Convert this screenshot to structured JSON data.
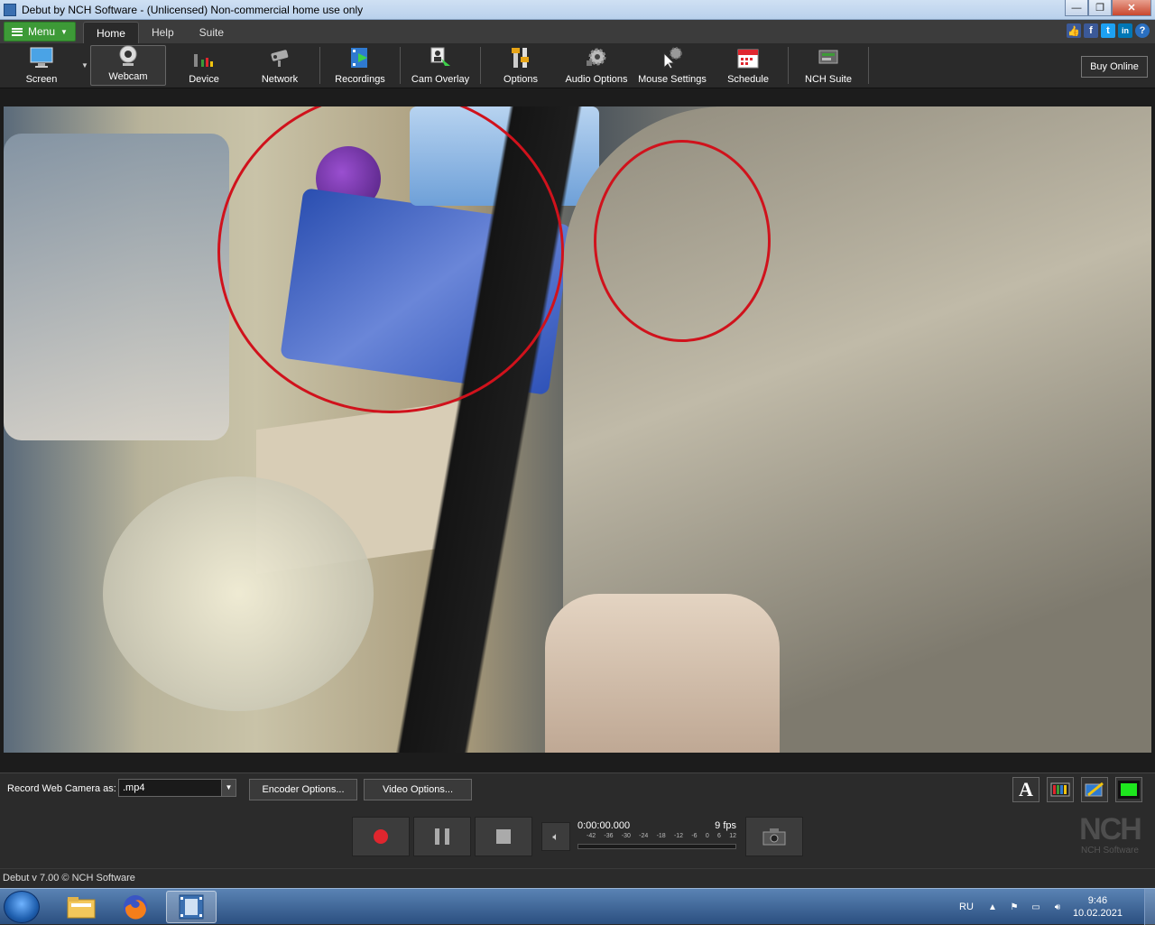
{
  "window": {
    "title": "Debut by NCH Software - (Unlicensed) Non-commercial home use only",
    "minimize": "—",
    "maximize": "❐",
    "close": "✕"
  },
  "tabs": {
    "menu_label": "Menu",
    "items": [
      "Home",
      "Help",
      "Suite"
    ],
    "active": "Home"
  },
  "social": [
    "👍",
    "f",
    "t",
    "in",
    "?"
  ],
  "toolbar": {
    "items": [
      {
        "label": "Screen",
        "icon": "monitor-icon"
      },
      {
        "label": "Webcam",
        "icon": "webcam-icon"
      },
      {
        "label": "Device",
        "icon": "device-icon"
      },
      {
        "label": "Network",
        "icon": "network-camera-icon"
      },
      {
        "label": "Recordings",
        "icon": "recordings-icon"
      },
      {
        "label": "Cam Overlay",
        "icon": "cam-overlay-icon"
      },
      {
        "label": "Options",
        "icon": "options-icon"
      },
      {
        "label": "Audio Options",
        "icon": "audio-options-icon"
      },
      {
        "label": "Mouse Settings",
        "icon": "mouse-settings-icon"
      },
      {
        "label": "Schedule",
        "icon": "calendar-icon"
      },
      {
        "label": "NCH Suite",
        "icon": "nch-suite-icon"
      }
    ],
    "active": "Webcam",
    "buy_label": "Buy Online"
  },
  "record": {
    "label": "Record Web Camera as:",
    "format": ".mp4",
    "encoder_btn": "Encoder Options...",
    "video_btn": "Video Options..."
  },
  "meter": {
    "time": "0:00:00.000",
    "fps": "9 fps",
    "scale": [
      "-42",
      "-36",
      "-30",
      "-24",
      "-18",
      "-12",
      "-6",
      "0",
      "6",
      "12"
    ]
  },
  "logo": {
    "big": "NCH",
    "small": "NCH Software"
  },
  "status": "Debut v 7.00 © NCH Software",
  "tray": {
    "lang": "RU",
    "time": "9:46",
    "date": "10.02.2021"
  },
  "colors": {
    "accent_green": "#3d9a37",
    "annotation_red": "#d0121c",
    "record_red": "#e0262e"
  }
}
